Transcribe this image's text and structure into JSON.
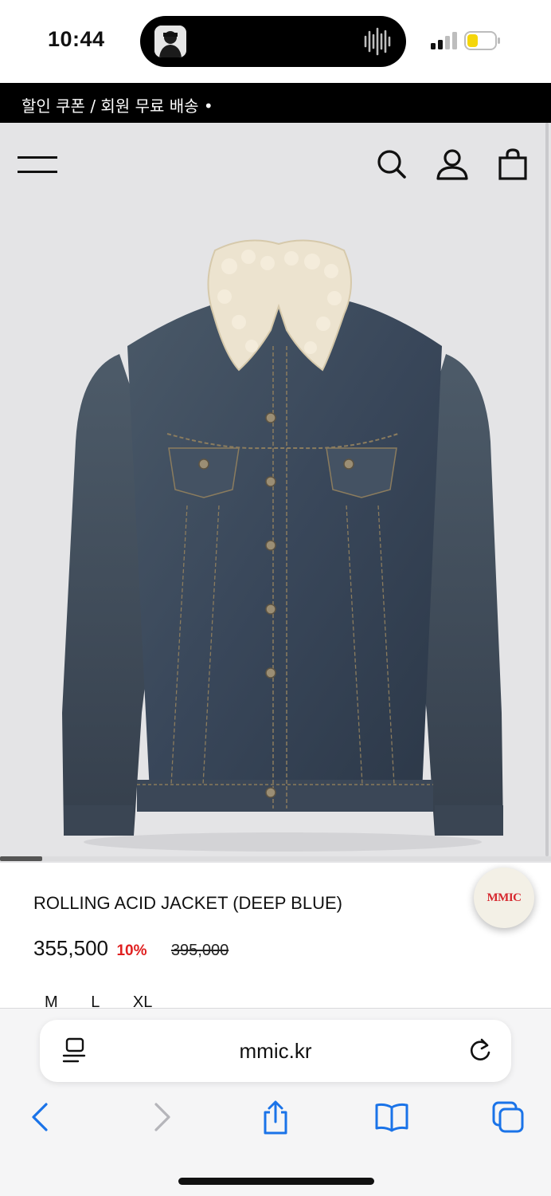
{
  "status_bar": {
    "time": "10:44",
    "battery_color": "#f5d60a"
  },
  "announcement": {
    "text": "할인 쿠폰 / 회원 무료 배송 •"
  },
  "header": {
    "icons": [
      "menu-icon",
      "search-icon",
      "account-icon",
      "cart-icon"
    ]
  },
  "product": {
    "name": "ROLLING ACID JACKET (DEEP BLUE)",
    "price": "355,500",
    "discount": "10%",
    "original_price": "395,000",
    "sizes": [
      "M",
      "L",
      "XL"
    ],
    "image_description_icon": "denim-jacket-image"
  },
  "brand_badge": {
    "text": "MMIC",
    "accent_color": "#d6282e"
  },
  "safari": {
    "url": "mmic.kr",
    "toolbar_icons": [
      "back-icon",
      "forward-icon",
      "share-icon",
      "bookmarks-icon",
      "tabs-icon"
    ],
    "accent_color": "#1a73e8"
  }
}
